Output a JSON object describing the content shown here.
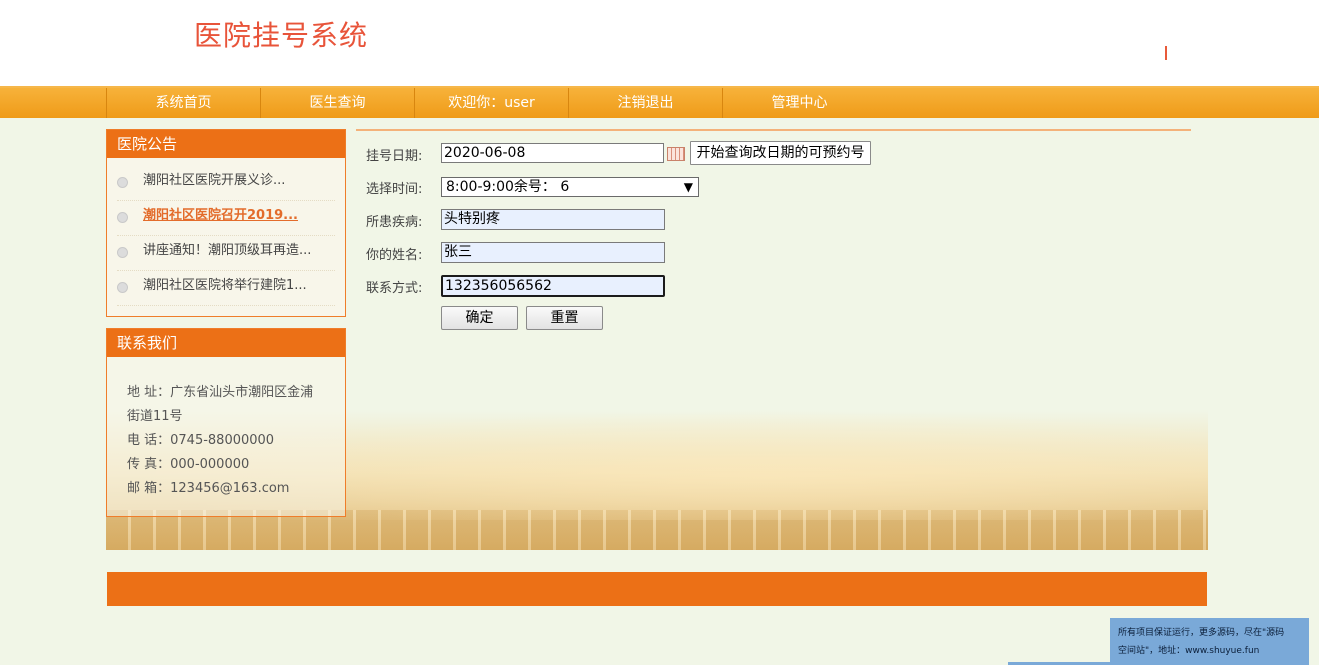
{
  "header": {
    "title": "医院挂号系统"
  },
  "nav": [
    {
      "label": "系统首页"
    },
    {
      "label": "医生查询"
    },
    {
      "label": "欢迎你：user"
    },
    {
      "label": "注销退出"
    },
    {
      "label": "管理中心"
    }
  ],
  "notices": {
    "title": "医院公告",
    "items": [
      {
        "text": "潮阳社区医院开展义诊..."
      },
      {
        "text": "潮阳社区医院召开2019..."
      },
      {
        "text": "讲座通知！潮阳顶级耳再造..."
      },
      {
        "text": "潮阳社区医院将举行建院1..."
      }
    ]
  },
  "contact": {
    "title": "联系我们",
    "address_line1": "地 址：广东省汕头市潮阳区金浦",
    "address_line2": "街道11号",
    "phone": "电 话：0745-88000000",
    "fax": "传 真：000-000000",
    "email": "邮 箱：123456@163.com"
  },
  "form": {
    "date_label": "挂号日期:",
    "date_value": "2020-06-08",
    "query_button": "开始查询改日期的可预约号",
    "time_label": "选择时间:",
    "time_selected": "8:00-9:00余号：  6",
    "disease_label": "所患疾病:",
    "disease_value": "头特别疼",
    "name_label": "你的姓名:",
    "name_value": "张三",
    "contact_label": "联系方式:",
    "contact_value": "132356056562",
    "confirm_button": "确定",
    "reset_button": "重置"
  },
  "watermark": {
    "line1": "所有项目保证运行，更多源码，尽在\"源码",
    "line2": "空间站\"，地址：www.shuyue.fun"
  }
}
